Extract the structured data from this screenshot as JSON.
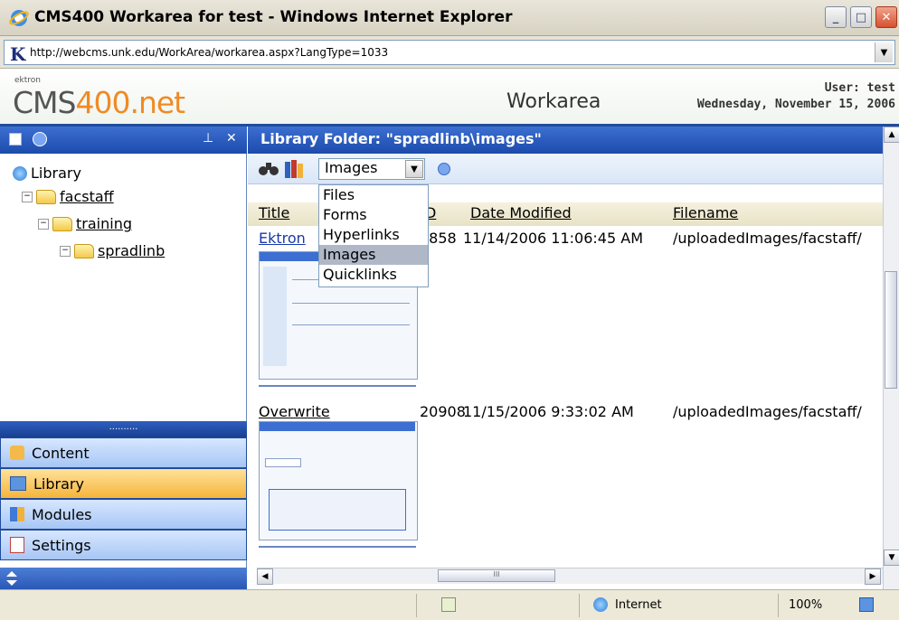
{
  "window": {
    "title": "CMS400 Workarea for test - Windows Internet Explorer",
    "min": "_",
    "max": "□",
    "close": "✕"
  },
  "address": {
    "k_glyph": "K",
    "url": "http://webcms.unk.edu/WorkArea/workarea.aspx?LangType=1033",
    "dropdown": "▼"
  },
  "header": {
    "logo_small": "ektron",
    "logo_cms": "CMS",
    "logo_400": "400",
    "logo_net": ".net",
    "section": "Workarea",
    "user": "User: test",
    "date": "Wednesday, November 15, 2006"
  },
  "left": {
    "pin": "⊥",
    "close": "✕",
    "tree": {
      "root": "Library",
      "items": [
        {
          "label": "facstaff"
        },
        {
          "label": "training"
        },
        {
          "label": "spradlinb"
        }
      ]
    },
    "splitter": "..........",
    "nav": [
      {
        "label": "Content",
        "icon": "content-icon"
      },
      {
        "label": "Library",
        "icon": "library-icon"
      },
      {
        "label": "Modules",
        "icon": "modules-icon"
      },
      {
        "label": "Settings",
        "icon": "settings-icon"
      }
    ]
  },
  "content": {
    "title": "Library Folder: \"spradlinb\\images\"",
    "type_selected": "Images",
    "type_options": [
      "Files",
      "Forms",
      "Hyperlinks",
      "Images",
      "Quicklinks"
    ],
    "columns": {
      "title": "Title",
      "id": "D",
      "date": "Date Modified",
      "filename": "Filename"
    },
    "rows": [
      {
        "title": "Ektron",
        "id": "0858",
        "date": "11/14/2006 11:06:45 AM",
        "filename": "/uploadedImages/facstaff/"
      },
      {
        "title": "Overwrite",
        "id": "20908",
        "date": "11/15/2006 9:33:02 AM",
        "filename": "/uploadedImages/facstaff/"
      }
    ],
    "hscroll_center": "III"
  },
  "status": {
    "zone": "Internet",
    "zoom": "100%"
  }
}
